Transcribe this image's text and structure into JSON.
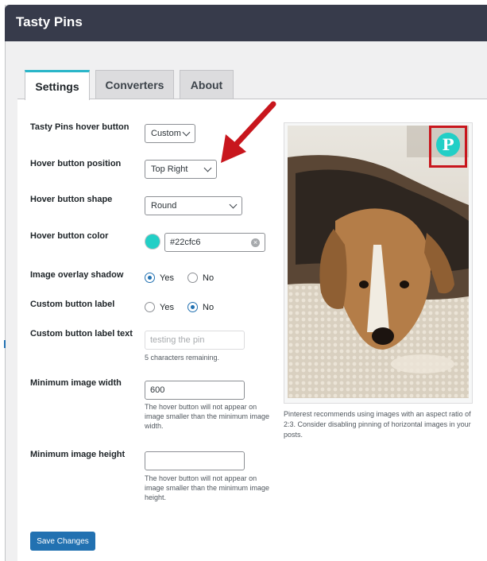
{
  "app": {
    "title": "Tasty Pins"
  },
  "tabs": [
    {
      "label": "Settings",
      "active": true
    },
    {
      "label": "Converters",
      "active": false
    },
    {
      "label": "About",
      "active": false
    }
  ],
  "fields": {
    "hover_button": {
      "label": "Tasty Pins hover button",
      "value": "Custom"
    },
    "position": {
      "label": "Hover button position",
      "value": "Top Right"
    },
    "shape": {
      "label": "Hover button shape",
      "value": "Round"
    },
    "color": {
      "label": "Hover button color",
      "value": "#22cfc6"
    },
    "overlay_shadow": {
      "label": "Image overlay shadow",
      "options": [
        "Yes",
        "No"
      ],
      "selected": "Yes"
    },
    "custom_label": {
      "label": "Custom button label",
      "options": [
        "Yes",
        "No"
      ],
      "selected": "No"
    },
    "custom_label_text": {
      "label": "Custom button label text",
      "value": "testing the pin",
      "help": "5 characters remaining."
    },
    "min_width": {
      "label": "Minimum image width",
      "value": "600",
      "help": "The hover button will not appear on image smaller than the minimum image width."
    },
    "min_height": {
      "label": "Minimum image height",
      "value": "",
      "help": "The hover button will not appear on image smaller than the minimum image height."
    }
  },
  "preview": {
    "note": "Pinterest recommends using images with an aspect ratio of 2:3. Consider disabling pinning of horizontal images in your posts.",
    "pin_icon": "pinterest-icon"
  },
  "actions": {
    "save_label": "Save Changes"
  },
  "colors": {
    "topbar": "#373b4b",
    "accent_teal": "#22cfc6",
    "primary_button": "#2271b1",
    "annotation_red": "#c8161d"
  }
}
